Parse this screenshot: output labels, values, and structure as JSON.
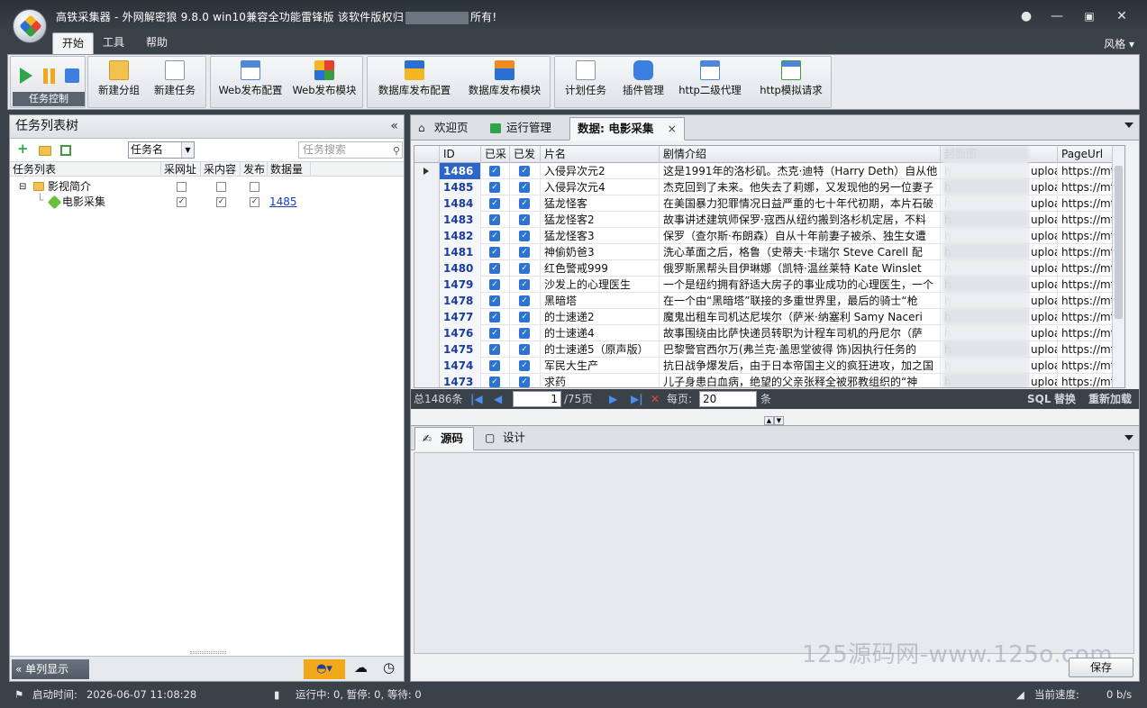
{
  "window": {
    "title_prefix": "高铁采集器 - 外网解密狼 9.8.0 win10兼容全功能雷锋版  该软件版权归",
    "title_suffix": "所有!",
    "controls": [
      "user",
      "minimize",
      "maximize",
      "close"
    ]
  },
  "menu": {
    "tabs": [
      {
        "label": "开始",
        "active": true
      },
      {
        "label": "工具",
        "active": false
      },
      {
        "label": "帮助",
        "active": false
      }
    ],
    "style_label": "风格"
  },
  "ribbon": {
    "task_control_label": "任务控制",
    "buttons": [
      {
        "label": "新建分组",
        "icon": "folder-icon"
      },
      {
        "label": "新建任务",
        "icon": "new-document-icon"
      },
      {
        "label": "Web发布配置",
        "icon": "web-config-icon"
      },
      {
        "label": "Web发布模块",
        "icon": "web-module-icon"
      },
      {
        "label": "数据库发布配置",
        "icon": "database-config-icon"
      },
      {
        "label": "数据库发布模块",
        "icon": "database-module-icon"
      },
      {
        "label": "计划任务",
        "icon": "schedule-icon"
      },
      {
        "label": "插件管理",
        "icon": "plugin-icon"
      },
      {
        "label": "http二级代理",
        "icon": "http-icon"
      },
      {
        "label": "http模拟请求",
        "icon": "http-request-icon"
      }
    ]
  },
  "left_panel": {
    "title": "任务列表树",
    "filter_select": "任务名",
    "search_placeholder": "任务搜索",
    "columns": [
      "任务列表",
      "采网址",
      "采内容",
      "发布",
      "数据量"
    ],
    "tree": [
      {
        "name": "影视简介",
        "type": "folder",
        "col_url": false,
        "col_content": false,
        "col_publish": false,
        "count": ""
      },
      {
        "name": "电影采集",
        "type": "task",
        "col_url": true,
        "col_content": true,
        "col_publish": true,
        "count": "1485"
      }
    ],
    "single_column_label": "单列显示"
  },
  "right_panel": {
    "tabs": [
      {
        "label": "欢迎页",
        "icon": "home-icon",
        "active": false
      },
      {
        "label": "运行管理",
        "icon": "monitor-icon",
        "active": false
      },
      {
        "label": "数据: 电影采集",
        "icon": "",
        "active": true
      }
    ],
    "grid": {
      "columns": [
        "ID",
        "已采",
        "已发",
        "片名",
        "剧情介绍",
        "封面图",
        "PageUrl"
      ],
      "rows": [
        {
          "id": "1486",
          "title": "入侵异次元2",
          "desc": "这是1991年的洛杉矶。杰克·迪特（Harry Deth）自从他",
          "cover": "h",
          "cover_tail": "uploa",
          "url": "https://mtz"
        },
        {
          "id": "1485",
          "title": "入侵异次元4",
          "desc": "杰克回到了未来。他失去了莉娜，又发现他的另一位妻子",
          "cover": "h",
          "cover_tail": "uploa",
          "url": "https://mtz"
        },
        {
          "id": "1484",
          "title": "猛龙怪客",
          "desc": "在美国暴力犯罪情况日益严重的七十年代初期，本片石破",
          "cover": "h",
          "cover_tail": "uploa",
          "url": "https://mtz"
        },
        {
          "id": "1483",
          "title": "猛龙怪客2",
          "desc": "故事讲述建筑师保罗·寇西从纽约搬到洛杉机定居，不料",
          "cover": "h",
          "cover_tail": "uploa",
          "url": "https://mtz"
        },
        {
          "id": "1482",
          "title": "猛龙怪客3",
          "desc": "保罗（查尔斯·布朗森）自从十年前妻子被杀、独生女遭",
          "cover": "h",
          "cover_tail": "uploa",
          "url": "https://mtz"
        },
        {
          "id": "1481",
          "title": "神偷奶爸3",
          "desc": "洗心革面之后，格鲁（史蒂夫·卡瑞尔 Steve Carell 配",
          "cover": "h",
          "cover_tail": "uploa",
          "url": "https://mtz"
        },
        {
          "id": "1480",
          "title": "红色警戒999",
          "desc": "俄罗斯黑帮头目伊琳娜（凯特·温丝莱特 Kate Winslet",
          "cover": "h",
          "cover_tail": "uploa",
          "url": "https://mtz"
        },
        {
          "id": "1479",
          "title": "沙发上的心理医生",
          "desc": "一个是纽约拥有舒适大房子的事业成功的心理医生，一个",
          "cover": "h",
          "cover_tail": "uploa",
          "url": "https://mtz"
        },
        {
          "id": "1478",
          "title": "黑暗塔",
          "desc": "在一个由“黑暗塔”联接的多重世界里，最后的骑士“枪",
          "cover": "h",
          "cover_tail": "uploa",
          "url": "https://mtz"
        },
        {
          "id": "1477",
          "title": "的士速递2",
          "desc": "魔鬼出租车司机达尼埃尔（萨米·纳塞利 Samy Naceri",
          "cover": "h",
          "cover_tail": "uploa",
          "url": "https://mtz"
        },
        {
          "id": "1476",
          "title": "的士速递4",
          "desc": "故事围绕由比萨快递员转职为计程车司机的丹尼尔（萨",
          "cover": "h",
          "cover_tail": "uploa",
          "url": "https://mtz"
        },
        {
          "id": "1475",
          "title": "的士速递5（原声版）",
          "desc": "巴黎警官西尔万(弗兰克·盖思堂彼得 饰)因执行任务的",
          "cover": "h",
          "cover_tail": "uploa",
          "url": "https://mtz"
        },
        {
          "id": "1474",
          "title": "军民大生产",
          "desc": "抗日战争爆发后，由于日本帝国主义的疯狂进攻，加之国",
          "cover": "h",
          "cover_tail": "uploa",
          "url": "https://mtz"
        },
        {
          "id": "1473",
          "title": "求药",
          "desc": "儿子身患白血病，绝望的父亲张释全被邪教组织的“神",
          "cover": "h",
          "cover_tail": "uploa",
          "url": "https://mtz"
        }
      ]
    },
    "pager": {
      "total": "总1486条",
      "page": "1",
      "pages": "/75页",
      "per_page_label": "每页:",
      "per_page": "20",
      "per_page_unit": "条",
      "sql": "SQL",
      "replace": "替换",
      "reload": "重新加载"
    },
    "bottom_tabs": [
      {
        "label": "源码",
        "active": true
      },
      {
        "label": "设计",
        "active": false
      }
    ],
    "save_label": "保存",
    "watermark": "125源码网-www.125o.com"
  },
  "status": {
    "start_time_label": "启动时间:",
    "start_time": "2026-06-07 11:08:28",
    "running_summary": "运行中: 0,  暂停: 0,  等待: 0",
    "speed_label": "当前速度:",
    "speed": "0 b/s"
  }
}
